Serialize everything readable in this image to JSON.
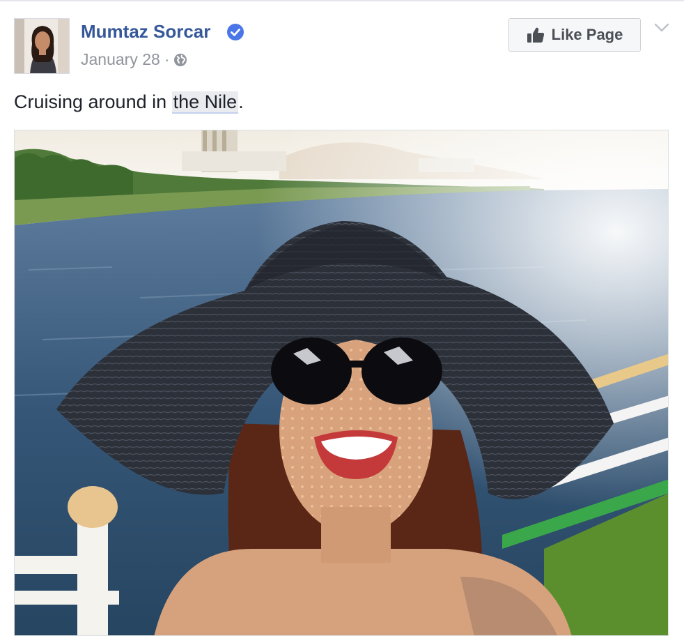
{
  "post": {
    "author": "Mumtaz Sorcar",
    "verified_icon": "verified-badge-icon",
    "date": "January 28",
    "separator": "·",
    "audience_icon": "globe-icon",
    "text_prefix": "Cruising around in ",
    "text_link": "the Nile",
    "text_suffix": "."
  },
  "actions": {
    "like_page_label": "Like Page",
    "like_icon": "thumbs-up-icon",
    "menu_icon": "chevron-down-icon"
  },
  "colors": {
    "author_link": "#365899",
    "verified_blue": "#4a76e8",
    "meta_gray": "#90949c",
    "button_bg": "#f6f7f9"
  }
}
